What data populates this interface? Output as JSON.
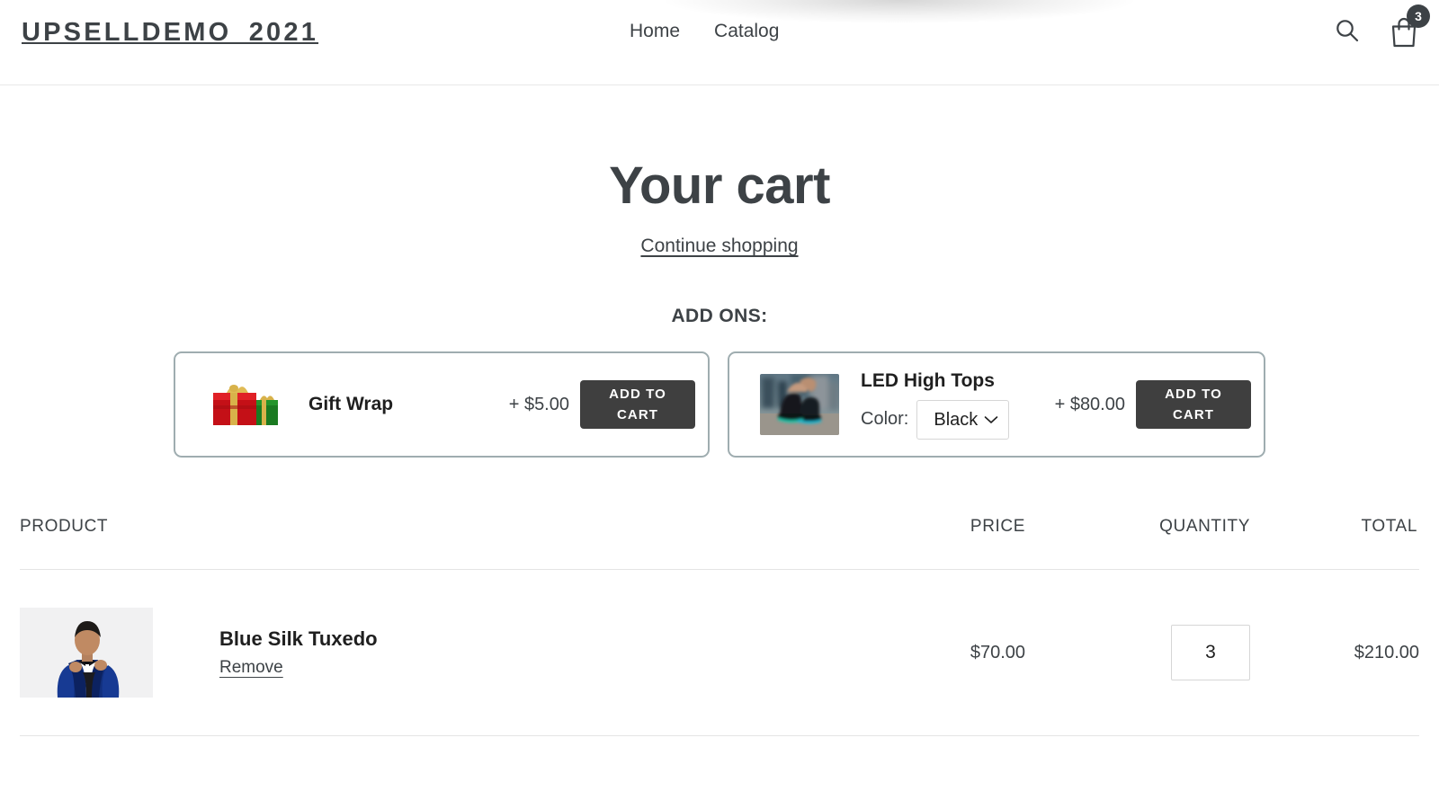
{
  "header": {
    "logo": "UPSELLDEMO_2021",
    "nav": [
      {
        "label": "Home"
      },
      {
        "label": "Catalog"
      }
    ],
    "search_icon": "search-icon",
    "cart_icon": "shopping-bag-icon",
    "cart_count": "3"
  },
  "page": {
    "title": "Your cart",
    "continue_shopping": "Continue shopping",
    "addons_heading": "ADD ONS:"
  },
  "addons": [
    {
      "name": "Gift Wrap",
      "image": "gift-boxes-image",
      "price": "+ $5.00",
      "button": "ADD TO CART",
      "has_variant": false
    },
    {
      "name": "LED High Tops",
      "image": "led-sneakers-photo",
      "price": "+ $80.00",
      "button": "ADD TO CART",
      "has_variant": true,
      "variant_label": "Color:",
      "variant_value": "Black",
      "variant_options": [
        "Black"
      ]
    }
  ],
  "cart": {
    "columns": {
      "product": "PRODUCT",
      "price": "PRICE",
      "quantity": "QUANTITY",
      "total": "TOTAL"
    },
    "items": [
      {
        "image": "blue-tuxedo-photo",
        "name": "Blue Silk Tuxedo",
        "remove_label": "Remove",
        "price": "$70.00",
        "quantity": "3",
        "total": "$210.00"
      }
    ]
  },
  "colors": {
    "text": "#3d4246",
    "button_bg": "#3f3f3f",
    "card_border": "#9fadb0",
    "divider": "#e4e4e4"
  }
}
